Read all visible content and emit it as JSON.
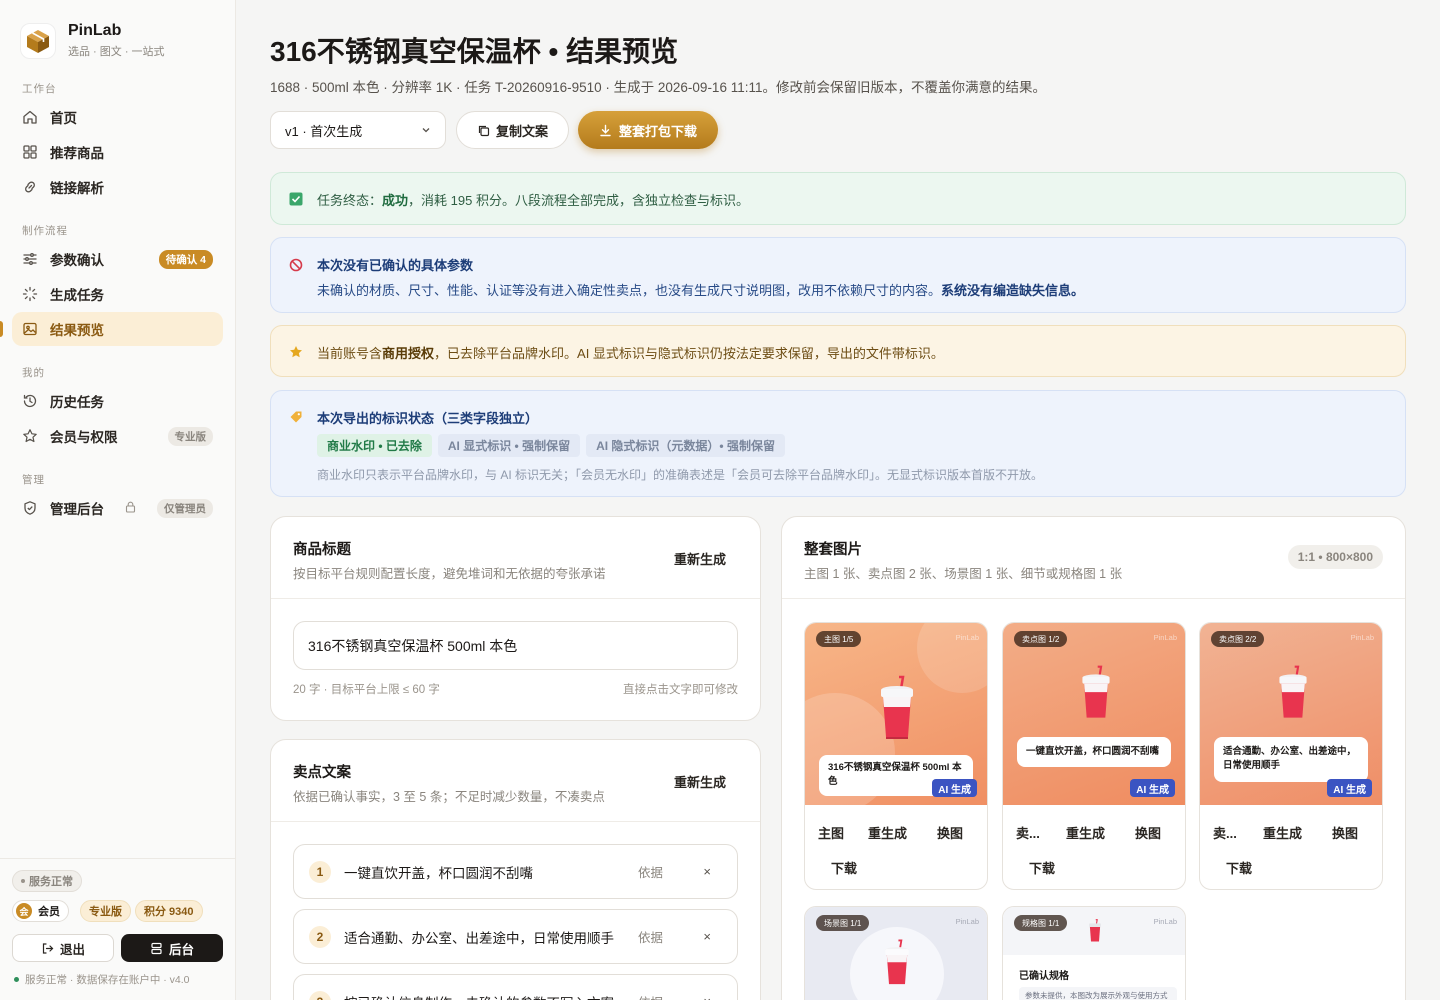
{
  "brand": {
    "name": "PinLab",
    "tagline": "选品 · 图文 · 一站式"
  },
  "nav": {
    "sections": [
      {
        "label": "工作台",
        "items": [
          {
            "label": "首页"
          },
          {
            "label": "推荐商品"
          },
          {
            "label": "链接解析"
          }
        ]
      },
      {
        "label": "制作流程",
        "items": [
          {
            "label": "参数确认",
            "badge": "待确认 4"
          },
          {
            "label": "生成任务"
          },
          {
            "label": "结果预览",
            "active": true
          }
        ]
      },
      {
        "label": "我的",
        "items": [
          {
            "label": "历史任务"
          },
          {
            "label": "会员与权限",
            "badge": "专业版"
          }
        ]
      },
      {
        "label": "管理",
        "items": [
          {
            "label": "管理后台",
            "badge": "仅管理员"
          }
        ]
      }
    ]
  },
  "sidebar_footer": {
    "service_chip": "服务正常",
    "member_label": "会员",
    "member_icon_char": "会",
    "plan": "专业版",
    "points": "积分 9340",
    "logout": "退出",
    "admin": "后台",
    "status_line": "服务正常 · 数据保存在账户中 · v4.0"
  },
  "page": {
    "title": "316不锈钢真空保温杯 • 结果预览",
    "subtitle": "1688 · 500ml 本色 · 分辨率 1K · 任务 T-20260916-9510 · 生成于 2026-09-16 11:11。修改前会保留旧版本，不覆盖你满意的结果。"
  },
  "toolbar": {
    "version": "v1 · 首次生成",
    "copy": "复制文案",
    "download": "整套打包下载"
  },
  "notices": {
    "success": {
      "prefix": "任务终态：",
      "status": "成功",
      "rest": "，消耗 195 积分。八段流程全部完成，含独立检查与标识。"
    },
    "params": {
      "title": "本次没有已确认的具体参数",
      "body": "未确认的材质、尺寸、性能、认证等没有进入确定性卖点，也没有生成尺寸说明图，改用不依赖尺寸的内容。",
      "emphasis": "系统没有编造缺失信息。"
    },
    "license": {
      "prefix": "当前账号含",
      "emphasis": "商用授权",
      "rest": "，已去除平台品牌水印。AI 显式标识与隐式标识仍按法定要求保留，导出的文件带标识。"
    },
    "marks": {
      "title": "本次导出的标识状态（三类字段独立）",
      "tags": [
        "商业水印 • 已去除",
        "AI 显式标识 • 强制保留",
        "AI 隐式标识（元数据）• 强制保留"
      ],
      "note": "商业水印只表示平台品牌水印，与 AI 标识无关；「会员无水印」的准确表述是「会员可去除平台品牌水印」。无显式标识版本首版不开放。"
    }
  },
  "title_card": {
    "title": "商品标题",
    "desc": "按目标平台规则配置长度，避免堆词和无依据的夸张承诺",
    "action": "重新生成",
    "value": "316不锈钢真空保温杯 500ml 本色",
    "meta_left": "20 字 · 目标平台上限 ≤ 60 字",
    "meta_right": "直接点击文字即可修改"
  },
  "copy_card": {
    "title": "卖点文案",
    "desc": "依据已确认事实，3 至 5 条；不足时减少数量，不凑卖点",
    "action": "重新生成",
    "basis_label": "依据",
    "delete_symbol": "×",
    "items": [
      {
        "num": "1",
        "text": "一键直饮开盖，杯口圆润不刮嘴"
      },
      {
        "num": "2",
        "text": "适合通勤、办公室、出差途中，日常使用顺手"
      },
      {
        "num": "3",
        "text": "按已确认信息制作，未确认的参数不写入文案"
      }
    ]
  },
  "images_card": {
    "title": "整套图片",
    "desc": "主图 1 张、卖点图 2 张、场景图 1 张、细节或规格图 1 张",
    "ratio": "1:1 • 800×800",
    "watermark": "PinLab",
    "ai_badge": "AI 生成",
    "actions": {
      "regen": "重生成",
      "swap": "换图",
      "download": "下载"
    },
    "images": [
      {
        "tag": "主图 1/5",
        "text": "316不锈钢真空保温杯 500ml 本色",
        "label": "主图"
      },
      {
        "tag": "卖点图 1/2",
        "text": "一键直饮开盖，杯口圆润不刮嘴",
        "label": "卖..."
      },
      {
        "tag": "卖点图 2/2",
        "text": "适合通勤、办公室、出差途中，日常使用顺手",
        "label": "卖..."
      },
      {
        "tag": "场景图 1/1"
      },
      {
        "tag": "规格图 1/1",
        "spec_title": "已确认规格",
        "spec_note": "参数未提供，本图改为展示外观与使用方式"
      }
    ]
  },
  "colors": {
    "accent": "#c98b25",
    "success": "#2f8f5b",
    "info": "#3b54c2",
    "danger": "#d63a4a"
  }
}
